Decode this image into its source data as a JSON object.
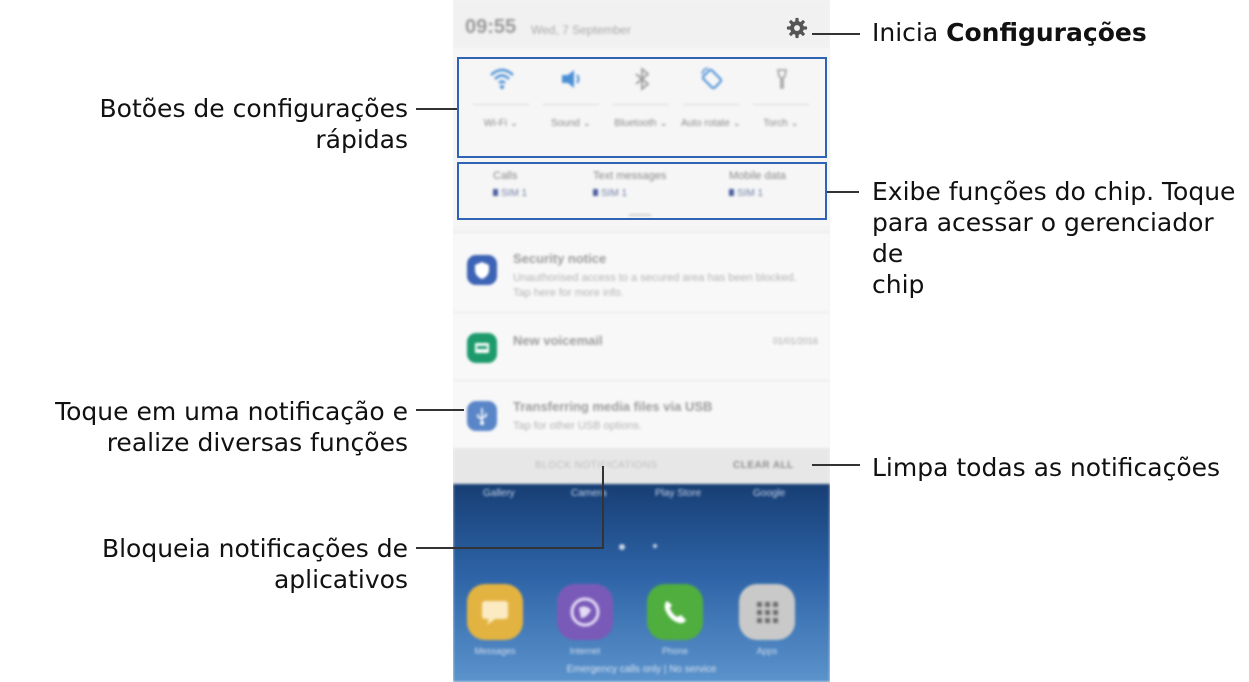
{
  "status_bar": {
    "time": "09:55",
    "date": "Wed, 7 September"
  },
  "quick_settings": [
    {
      "icon": "wifi-icon",
      "label": "Wi-Fi ⌄"
    },
    {
      "icon": "sound-icon",
      "label": "Sound ⌄"
    },
    {
      "icon": "bluetooth-icon",
      "label": "Bluetooth ⌄"
    },
    {
      "icon": "auto-rotate-icon",
      "label": "Auto rotate ⌄"
    },
    {
      "icon": "torch-icon",
      "label": "Torch ⌄"
    }
  ],
  "sim_functions": [
    {
      "title": "Calls",
      "sim": "SIM 1"
    },
    {
      "title": "Text messages",
      "sim": "SIM 1"
    },
    {
      "title": "Mobile data",
      "sim": "SIM 1"
    }
  ],
  "notifications": [
    {
      "icon": "shield-icon",
      "color": "#3c63b5",
      "title": "Security notice",
      "body": "Unauthorised access to a secured area has been blocked. Tap here for more info.",
      "date": ""
    },
    {
      "icon": "voicemail-icon",
      "color": "#1c9a6c",
      "title": "New voicemail",
      "body": "",
      "date": "01/01/2016"
    },
    {
      "icon": "usb-icon",
      "color": "#5a86c8",
      "title": "Transferring media files via USB",
      "body": "Tap for other USB options.",
      "date": ""
    }
  ],
  "actions": {
    "block": "BLOCK NOTIFICATIONS",
    "clear": "CLEAR ALL"
  },
  "home": {
    "dock_labels": [
      "Gallery",
      "Camera",
      "Play Store",
      "Google"
    ],
    "apps": [
      {
        "icon": "messages-icon",
        "label": "Messages",
        "color": "#e3b341"
      },
      {
        "icon": "internet-icon",
        "label": "Internet",
        "color": "#7a5ab8"
      },
      {
        "icon": "phone-icon",
        "label": "Phone",
        "color": "#4fae3e"
      },
      {
        "icon": "apps-icon",
        "label": "Apps",
        "color": "#c9c9c9"
      }
    ],
    "emergency": "Emergency calls only | No service"
  },
  "annotations": {
    "settings_pre": "Inicia ",
    "settings_bold": "Configurações",
    "quick": "Botões de configurações rápidas",
    "sim_line1": "Exibe funções do chip. Toque",
    "sim_line2": "para acessar o gerenciador de",
    "sim_line3": "chip",
    "notif_line1": "Toque em uma notificação e",
    "notif_line2": "realize diversas funções",
    "clear": "Limpa todas as notificações",
    "block_line1": "Bloqueia notificações de",
    "block_line2": "aplicativos"
  },
  "colors": {
    "highlight": "#2f63b3",
    "accent_blue": "#4d5fa0"
  }
}
